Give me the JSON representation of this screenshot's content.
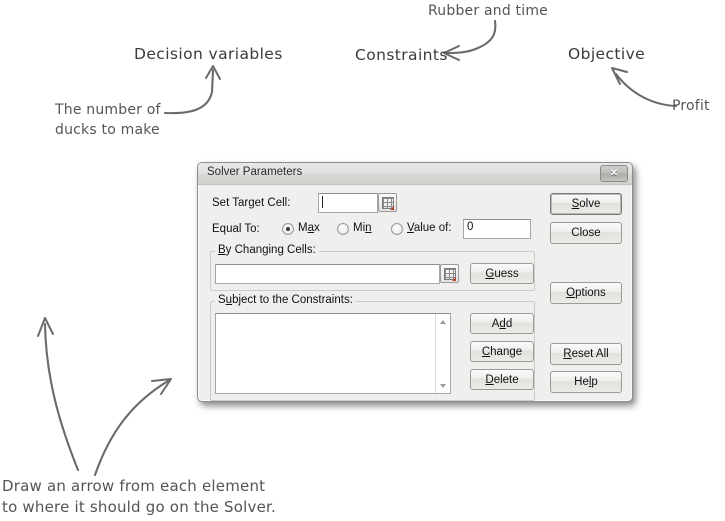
{
  "page": {
    "background": "#ffffff",
    "ink_color": "#4c4c4c"
  },
  "annotations": {
    "titles": [
      {
        "id": "decision-variables",
        "text": "Decision variables"
      },
      {
        "id": "constraints",
        "text": "Constraints"
      },
      {
        "id": "objective",
        "text": "Objective"
      }
    ],
    "notes": [
      {
        "id": "ducks-note",
        "line1": "The number of",
        "line2": "ducks to make"
      },
      {
        "id": "rubber-time-note",
        "text": "Rubber and time"
      },
      {
        "id": "profit-note",
        "text": "Profit"
      }
    ],
    "instruction": {
      "line1": "Draw an arrow from each element",
      "line2": "to where it should go on the Solver."
    },
    "arrow_count": 5
  },
  "dialog": {
    "title": "Solver Parameters",
    "close_label": "✕",
    "fields": {
      "set_target_cell_label": "Set Target Cell:",
      "set_target_cell_value": "",
      "equal_to_label": "Equal To:",
      "radios": [
        {
          "id": "max",
          "label_pre": "M",
          "label_key": "a",
          "label_post": "x",
          "full": "Max",
          "checked": true
        },
        {
          "id": "min",
          "label_pre": "Mi",
          "label_key": "n",
          "label_post": "",
          "full": "Min",
          "checked": false
        },
        {
          "id": "value-of",
          "label_pre": "",
          "label_key": "V",
          "label_post": "alue of:",
          "full": "Value of:",
          "checked": false
        }
      ],
      "value_of_value": "0",
      "by_changing_cells_legend": "By Changing Cells:",
      "by_changing_cells_value": "",
      "subject_to_constraints_legend": "Subject to the Constraints:",
      "constraints_items": []
    },
    "buttons": {
      "guess": "Guess",
      "add": "Add",
      "change": "Change",
      "delete": "Delete",
      "solve": "Solve",
      "close": "Close",
      "options": "Options",
      "reset_all": "Reset All",
      "help": "Help"
    },
    "icons": {
      "range_picker": "spreadsheet-range-picker-icon",
      "scroll_up": "scroll-up-arrow-icon",
      "scroll_down": "scroll-down-arrow-icon",
      "close": "close-icon"
    }
  }
}
